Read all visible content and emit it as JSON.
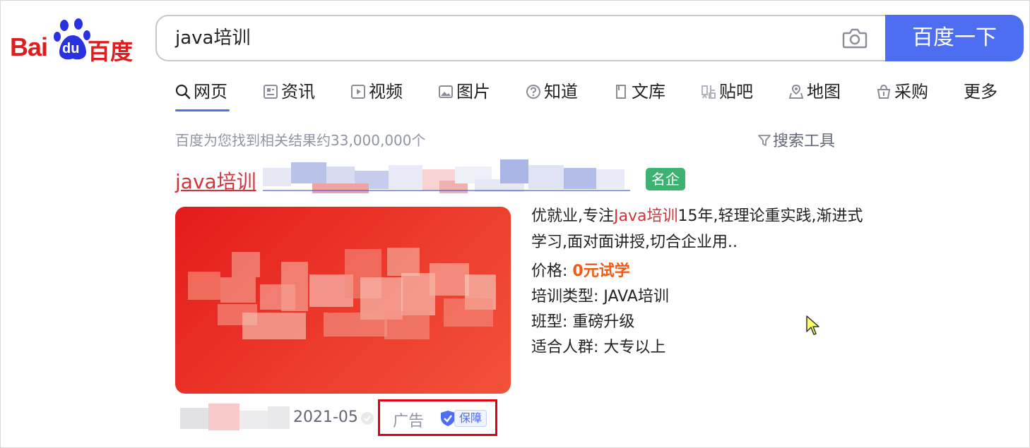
{
  "logo": {
    "text_latin": "Bai",
    "text_paw": "du",
    "text_cn": "百度"
  },
  "search": {
    "query": "java培训",
    "button_label": "百度一下"
  },
  "tabs": [
    {
      "label": "网页",
      "icon": "search-icon"
    },
    {
      "label": "资讯",
      "icon": "news-icon"
    },
    {
      "label": "视频",
      "icon": "video-icon"
    },
    {
      "label": "图片",
      "icon": "image-icon"
    },
    {
      "label": "知道",
      "icon": "question-icon"
    },
    {
      "label": "文库",
      "icon": "document-icon"
    },
    {
      "label": "贴吧",
      "icon": "tieba-icon"
    },
    {
      "label": "地图",
      "icon": "map-icon"
    },
    {
      "label": "采购",
      "icon": "purchase-icon"
    },
    {
      "label": "更多"
    }
  ],
  "result_count": "百度为您找到相关结果约33,000,000个",
  "search_tools": "搜索工具",
  "result": {
    "title": "java培训",
    "badge": "名企",
    "desc_pre": "优就业,专注",
    "desc_highlight": "Java培训",
    "desc_post": "15年,轻理论重实践,渐进式学习,面对面讲授,切合企业用..",
    "info": [
      {
        "label": "价格:",
        "value": "0元试学"
      },
      {
        "label": "培训类型:",
        "value": "JAVA培训"
      },
      {
        "label": "班型:",
        "value": "重磅升级"
      },
      {
        "label": "适合人群:",
        "value": "大专以上"
      }
    ],
    "date": "2021-05",
    "ad_label": "广告",
    "guarantee_label": "保障"
  },
  "colors": {
    "brand_blue": "#4e6ef2",
    "brand_red": "#de1e1e",
    "link_red": "#d1343b",
    "badge_green": "#3cb371",
    "price_orange": "#f05a14",
    "highlight_box": "#e00012"
  }
}
